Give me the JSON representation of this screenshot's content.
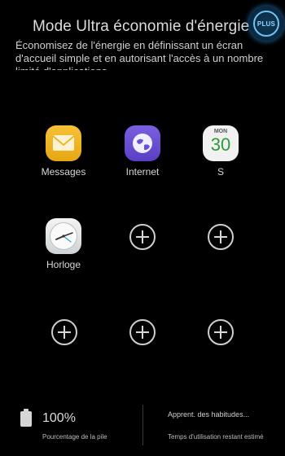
{
  "header": {
    "title": "Mode Ultra économie d'énergie",
    "description": "Économisez de l'énergie en définissant un écran d'accueil simple et en autorisant l'accès à un nombre limité d'applications.",
    "plus_label": "PLUS"
  },
  "apps": [
    {
      "label": "Messages",
      "icon": "messages-icon"
    },
    {
      "label": "Internet",
      "icon": "internet-globe-icon"
    },
    {
      "label": "S",
      "icon": "calendar-icon",
      "calendar_month": "MON",
      "calendar_day": "30"
    },
    {
      "label": "Horloge",
      "icon": "clock-icon"
    }
  ],
  "empty_slots": 5,
  "footer": {
    "battery_value": "100%",
    "battery_caption": "Pourcentage de la pile",
    "usage_status": "Apprent. des habitudes...",
    "usage_caption": "Temps d'utilisation restant estimé"
  },
  "colors": {
    "background": "#000000",
    "plus_glow": "#288cd2",
    "messages_icon": "#f2b52a",
    "internet_icon": "#6a4fd8",
    "calendar_day": "#2d9a3a"
  }
}
